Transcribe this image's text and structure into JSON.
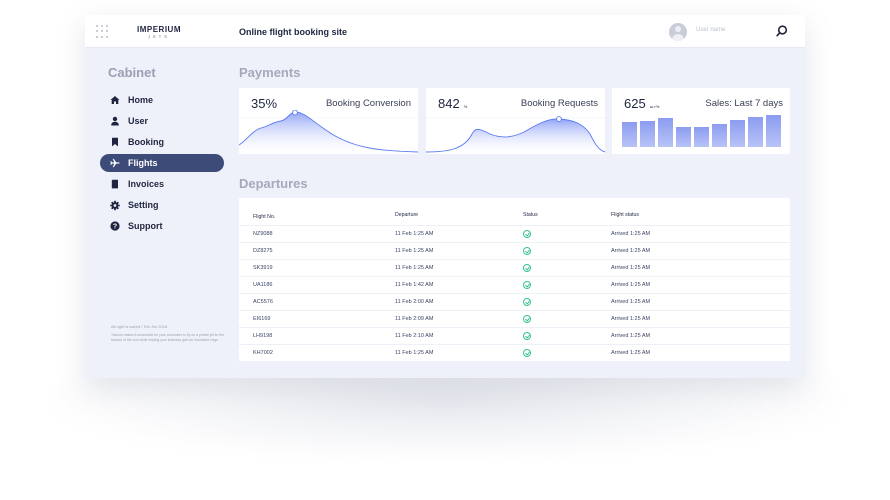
{
  "header": {
    "logo_line1": "IMPERIUM",
    "logo_line2": "JETS",
    "site_title": "Online flight booking site",
    "username_placeholder": "User name"
  },
  "sidebar": {
    "title": "Cabinet",
    "items": [
      {
        "label": "Home",
        "icon": "home-icon",
        "active": false
      },
      {
        "label": "User",
        "icon": "user-icon",
        "active": false
      },
      {
        "label": "Booking",
        "icon": "bookmark-icon",
        "active": false
      },
      {
        "label": "Flights",
        "icon": "plane-icon",
        "active": true
      },
      {
        "label": "Invoices",
        "icon": "file-icon",
        "active": false
      },
      {
        "label": "Setting",
        "icon": "gear-icon",
        "active": false
      },
      {
        "label": "Support",
        "icon": "help-icon",
        "active": false
      }
    ],
    "footer_line1": "All right is saved  /  Tob Jim 2018",
    "footer_line2": "Tokuma makes it accessible for your customers to fly on a private jet for the fraction of the cost while helping your business gain an innovative edge."
  },
  "payments": {
    "title": "Payments",
    "cards": [
      {
        "value": "35%",
        "unit": "",
        "label": "Booking Conversion"
      },
      {
        "value": "842",
        "unit": "%",
        "label": "Booking Requests"
      },
      {
        "value": "625",
        "unit": "ш.т%",
        "label": "Sales: Last 7 days"
      }
    ],
    "sales_bars": [
      0.55,
      0.58,
      0.64,
      0.45,
      0.45,
      0.5,
      0.6,
      0.67,
      0.72
    ]
  },
  "departures": {
    "title": "Departures",
    "columns": [
      "Flight No.",
      "Departure",
      "Status",
      "Flight status"
    ],
    "rows": [
      [
        "NZ9088",
        "11 Feb 1:25 AM",
        "ok",
        "Arrived 1:25 AM"
      ],
      [
        "DZ8275",
        "11 Feb 1:25 AM",
        "ok",
        "Arrived 1:25 AM"
      ],
      [
        "SK3919",
        "11 Feb 1:25 AM",
        "ok",
        "Arrived 1:25 AM"
      ],
      [
        "UA1186",
        "11 Feb 1:42 AM",
        "ok",
        "Arrived 1:25 AM"
      ],
      [
        "AC5576",
        "11 Feb 2:00 AM",
        "ok",
        "Arrived 1:25 AM"
      ],
      [
        "EI6169",
        "11 Feb 2:09 AM",
        "ok",
        "Arrived 1:25 AM"
      ],
      [
        "LH9198",
        "11 Feb 2:10 AM",
        "ok",
        "Arrived 1:25 AM"
      ],
      [
        "KH7002",
        "11 Feb 1:25 AM",
        "ok",
        "Arrived 1:25 AM"
      ]
    ]
  },
  "colors": {
    "accent": "#3d4b79",
    "status_ok": "#37c48e",
    "chart_blue": "#5b7bf0"
  }
}
